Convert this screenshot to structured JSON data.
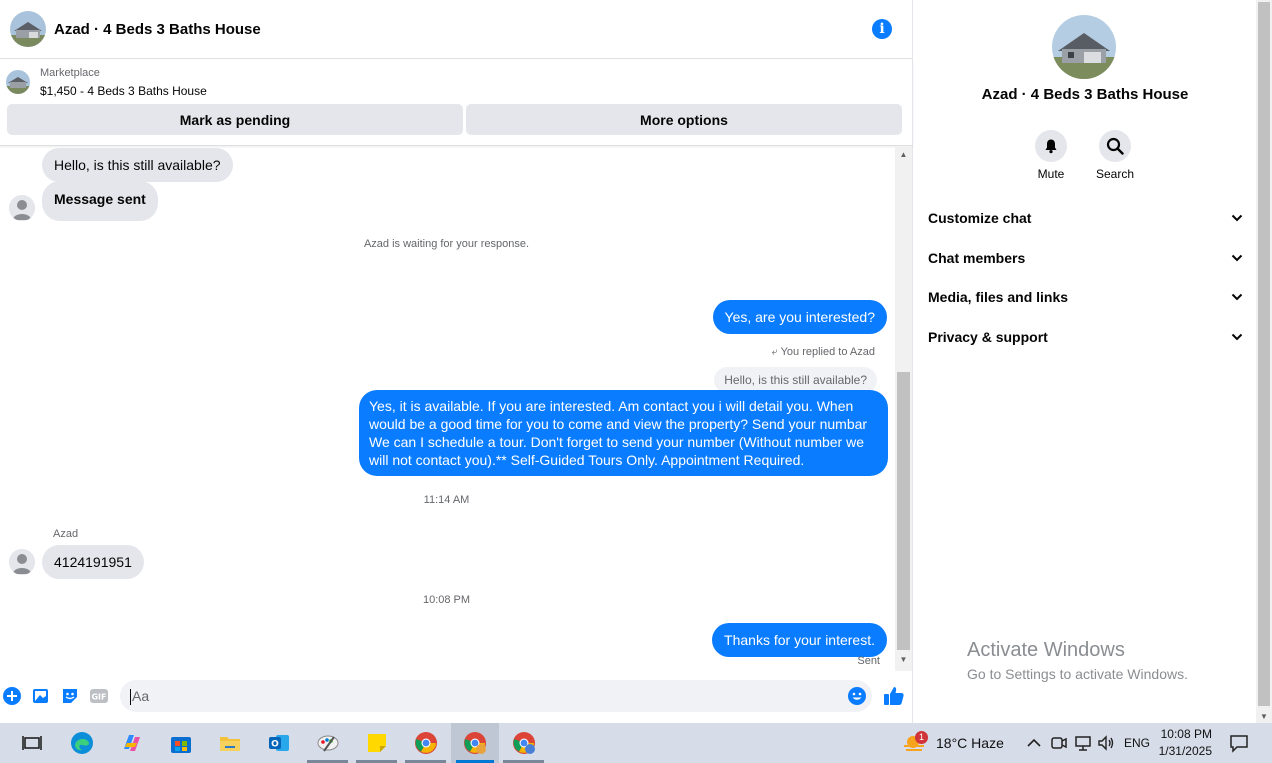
{
  "header": {
    "title": "Azad · 4 Beds 3 Baths House"
  },
  "marketplace": {
    "label": "Marketplace",
    "listing": "$1,450 - 4 Beds 3 Baths House",
    "pending_button": "Mark as pending",
    "options_button": "More options"
  },
  "messages": {
    "m1": "Hello, is this still available?",
    "m2": "Message sent",
    "waiting": "Azad is waiting for your response.",
    "m3": "Yes, are you interested?",
    "replied_to": "You replied to Azad",
    "quoted": "Hello, is this still available?",
    "m4": "Yes, it is available. If you are interested.  Am contact you i will detail you.  When would be a good time for you to come and view the property? Send your numbar We can I schedule a tour.  Don't forget to send your number (Without number we will not contact you).** Self-Guided Tours Only. Appointment Required.",
    "time1": "11:14 AM",
    "sender_name": "Azad",
    "m5": "4124191951",
    "time2": "10:08 PM",
    "m6": "Thanks for your interest.",
    "status": "Sent"
  },
  "composer": {
    "placeholder": "Aa"
  },
  "info_panel": {
    "name": "Azad · 4 Beds 3 Baths House",
    "mute_label": "Mute",
    "search_label": "Search",
    "sections": [
      "Customize chat",
      "Chat members",
      "Media, files and links",
      "Privacy & support"
    ]
  },
  "watermark": {
    "line1": "Activate Windows",
    "line2": "Go to Settings to activate Windows."
  },
  "taskbar": {
    "weather_badge": "1",
    "weather": "18°C  Haze",
    "language": "ENG",
    "time": "10:08 PM",
    "date": "1/31/2025"
  },
  "colors": {
    "accent": "#0a7cff",
    "bubble_in": "#e4e6eb",
    "taskbar": "#d6dce8"
  }
}
